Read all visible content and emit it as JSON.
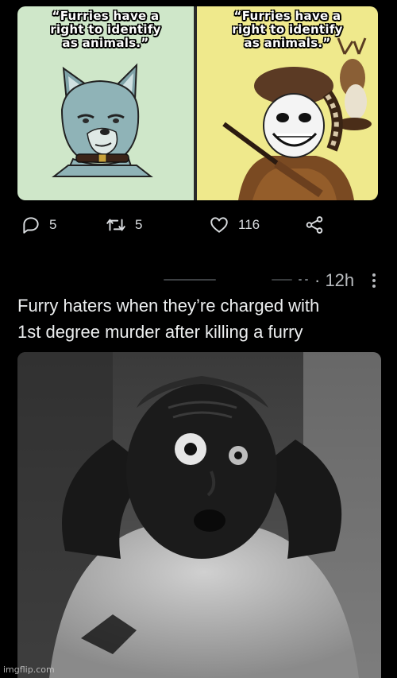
{
  "meme": {
    "left_caption": [
      "“Furries have a",
      "right to identify",
      "as animals.”"
    ],
    "right_caption": [
      "“Furries have a",
      "right to identify",
      "as animals.”"
    ]
  },
  "actions": {
    "replies": "5",
    "retweets": "5",
    "likes": "116"
  },
  "tweet2": {
    "timestamp": "· 12h",
    "text_lines": [
      "Furry haters when they’re charged with",
      "1st degree murder after killing a furry"
    ]
  },
  "watermark": "imgflip.com",
  "colors": {
    "background": "#000000",
    "left_panel": "#cfe7c9",
    "right_panel": "#efe98c",
    "text": "#e7e9ea",
    "muted": "#b9bcbf"
  },
  "icons": [
    "reply-icon",
    "retweet-icon",
    "like-icon",
    "share-icon",
    "more-icon"
  ]
}
